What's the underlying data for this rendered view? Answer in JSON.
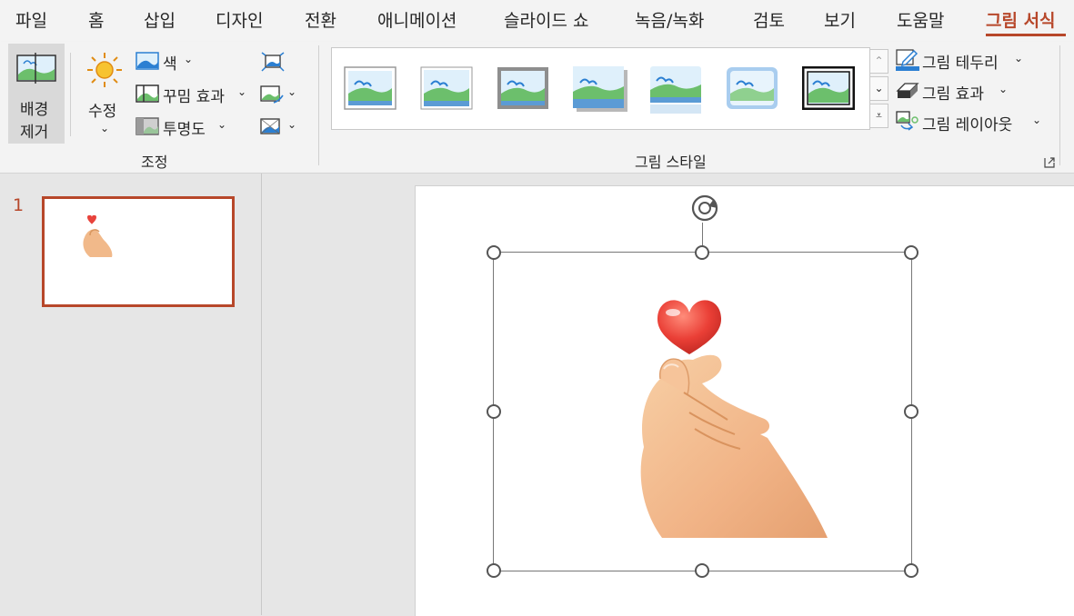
{
  "tabs": [
    "파일",
    "홈",
    "삽입",
    "디자인",
    "전환",
    "애니메이션",
    "슬라이드 쇼",
    "녹음/녹화",
    "검토",
    "보기",
    "도움말",
    "그림 서식"
  ],
  "ribbon": {
    "remove_bg_line1": "배경",
    "remove_bg_line2": "제거",
    "corrections": "수정",
    "color": "색",
    "artistic_effects": "꾸밈 효과",
    "transparency": "투명도",
    "adjust_group": "조정",
    "styles_group": "그림 스타일",
    "picture_border": "그림 테두리",
    "picture_effects": "그림 효과",
    "picture_layout": "그림 레이아웃"
  },
  "slides_panel": {
    "slide_number": "1"
  },
  "colors": {
    "accent": "#b7472a",
    "ribbon_bg": "#f3f3f3",
    "workspace_bg": "#e6e6e6"
  }
}
